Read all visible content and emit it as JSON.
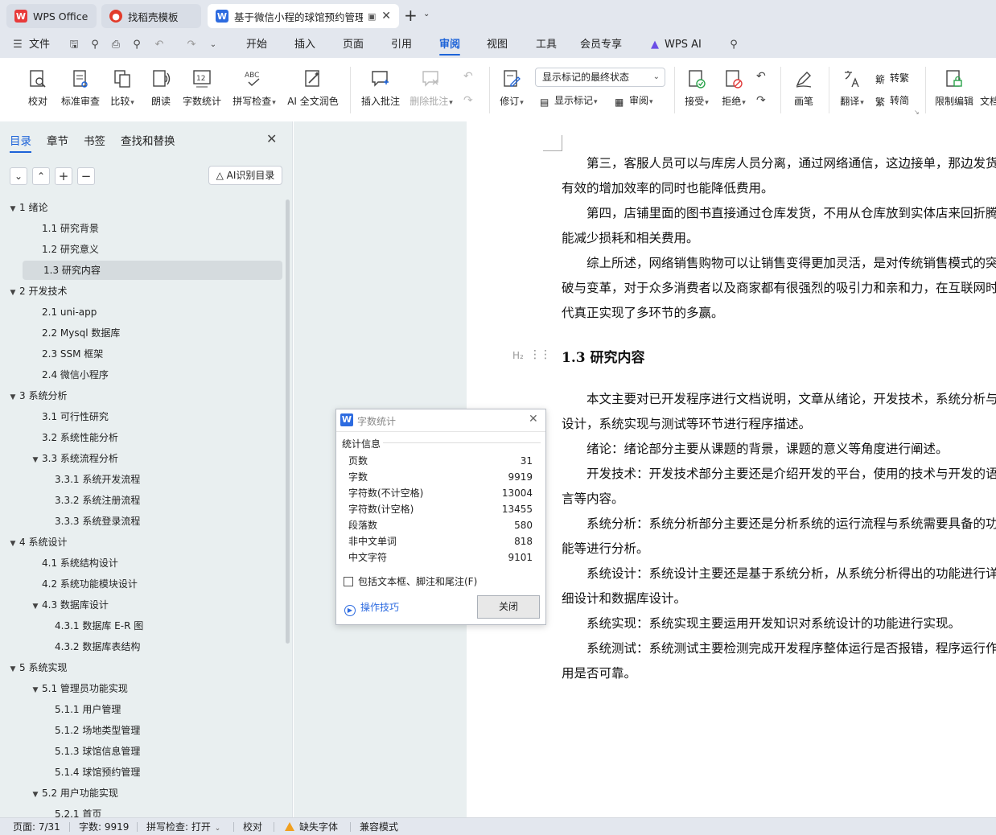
{
  "tabs": [
    {
      "label": "WPS Office",
      "icon": "wps-logo-icon"
    },
    {
      "label": "找稻壳模板",
      "icon": "docer-icon"
    },
    {
      "label": "基于微信小程的球馆预约管理",
      "icon": "wps-writer-icon"
    }
  ],
  "menu": {
    "file": "文件",
    "items": [
      "开始",
      "插入",
      "页面",
      "引用",
      "审阅",
      "视图",
      "工具",
      "会员专享"
    ],
    "active": "审阅",
    "wps_ai": "WPS AI"
  },
  "ribbon": {
    "proofread": "校对",
    "standard_review": "标准审查",
    "compare": "比较",
    "read_aloud": "朗读",
    "word_count": "字数统计",
    "spell_check": "拼写检查",
    "ai_polish": "AI 全文润色",
    "insert_comment": "插入批注",
    "delete_comment": "删除批注",
    "track_changes": "修订",
    "markup_mode": "显示标记的最终状态",
    "show_markup": "显示标记",
    "review_pane": "审阅",
    "accept": "接受",
    "reject": "拒绝",
    "ink": "画笔",
    "translate": "翻译",
    "to_traditional": "转繁",
    "to_simplified": "转简",
    "restrict_editing": "限制编辑",
    "doc_rights": "文档"
  },
  "nav": {
    "tabs": [
      "目录",
      "章节",
      "书签",
      "查找和替换"
    ],
    "ai_toc": "AI识别目录",
    "toc": [
      {
        "label": "1  绪论",
        "level": 1,
        "expanded": true
      },
      {
        "label": "1.1  研究背景",
        "level": 2
      },
      {
        "label": "1.2  研究意义",
        "level": 2
      },
      {
        "label": "1.3  研究内容",
        "level": 2,
        "selected": true
      },
      {
        "label": "2  开发技术",
        "level": 1,
        "expanded": true
      },
      {
        "label": "2.1 uni-app",
        "level": 2
      },
      {
        "label": "2.2 Mysql 数据库",
        "level": 2
      },
      {
        "label": "2.3 SSM 框架",
        "level": 2
      },
      {
        "label": "2.4  微信小程序",
        "level": 2
      },
      {
        "label": "3  系统分析",
        "level": 1,
        "expanded": true
      },
      {
        "label": "3.1 可行性研究",
        "level": 2
      },
      {
        "label": "3.2 系统性能分析",
        "level": 2
      },
      {
        "label": "3.3  系统流程分析",
        "level": 2,
        "expanded": true
      },
      {
        "label": "3.3.1  系统开发流程",
        "level": 3
      },
      {
        "label": "3.3.2  系统注册流程",
        "level": 3
      },
      {
        "label": "3.3.3  系统登录流程",
        "level": 3
      },
      {
        "label": "4  系统设计",
        "level": 1,
        "expanded": true
      },
      {
        "label": "4.1  系统结构设计",
        "level": 2
      },
      {
        "label": "4.2 系统功能模块设计",
        "level": 2
      },
      {
        "label": "4.3 数据库设计",
        "level": 2,
        "expanded": true
      },
      {
        "label": "4.3.1 数据库 E-R 图",
        "level": 3
      },
      {
        "label": "4.3.2  数据库表结构",
        "level": 3
      },
      {
        "label": "5  系统实现",
        "level": 1,
        "expanded": true
      },
      {
        "label": "5.1  管理员功能实现",
        "level": 2,
        "expanded": true
      },
      {
        "label": "5.1.1  用户管理",
        "level": 3
      },
      {
        "label": "5.1.2  场地类型管理",
        "level": 3
      },
      {
        "label": "5.1.3  球馆信息管理",
        "level": 3
      },
      {
        "label": "5.1.4  球馆预约管理",
        "level": 3
      },
      {
        "label": "5.2  用户功能实现",
        "level": 2,
        "expanded": true
      },
      {
        "label": "5.2.1  首页",
        "level": 3
      }
    ]
  },
  "document": {
    "heading": "1.3  研究内容",
    "heading_marker": "H₂",
    "lines": [
      "　　第三，客服人员可以与库房人员分离，通过网络通信，这边接单，那边发货",
      "有效的增加效率的同时也能降低费用。",
      "　　第四，店铺里面的图书直接通过仓库发货，不用从仓库放到实体店来回折腾",
      "能减少损耗和相关费用。",
      "　　综上所述，网络销售购物可以让销售变得更加灵活，是对传统销售模式的突",
      "破与变革，对于众多消费者以及商家都有很强烈的吸引力和亲和力，在互联网时",
      "代真正实现了多环节的多赢。"
    ],
    "lines2": [
      "　　本文主要对已开发程序进行文档说明，文章从绪论，开发技术，系统分析与",
      "设计，系统实现与测试等环节进行程序描述。",
      "　　绪论：绪论部分主要从课题的背景，课题的意义等角度进行阐述。",
      "　　开发技术：开发技术部分主要还是介绍开发的平台，使用的技术与开发的语",
      "言等内容。",
      "　　系统分析：系统分析部分主要还是分析系统的运行流程与系统需要具备的功",
      "能等进行分析。",
      "　　系统设计：系统设计主要还是基于系统分析，从系统分析得出的功能进行详",
      "细设计和数据库设计。",
      "　　系统实现：系统实现主要运用开发知识对系统设计的功能进行实现。",
      "　　系统测试：系统测试主要检测完成开发程序整体运行是否报错，程序运行作",
      "用是否可靠。"
    ]
  },
  "dialog": {
    "title": "字数统计",
    "section": "统计信息",
    "stats": [
      {
        "label": "页数",
        "value": "31"
      },
      {
        "label": "字数",
        "value": "9919"
      },
      {
        "label": "字符数(不计空格)",
        "value": "13004"
      },
      {
        "label": "字符数(计空格)",
        "value": "13455"
      },
      {
        "label": "段落数",
        "value": "580"
      },
      {
        "label": "非中文单词",
        "value": "818"
      },
      {
        "label": "中文字符",
        "value": "9101"
      }
    ],
    "include_label": "包括文本框、脚注和尾注(F)",
    "tips": "操作技巧",
    "close": "关闭"
  },
  "status": {
    "page": "页面: 7/31",
    "words": "字数: 9919",
    "spell": "拼写检查: 打开",
    "proof": "校对",
    "missing_font": "缺失字体",
    "compat": "兼容模式"
  },
  "colors": {
    "accent": "#1d63d8",
    "wps_red": "#e83a3a",
    "writer_blue": "#2d6be0"
  }
}
